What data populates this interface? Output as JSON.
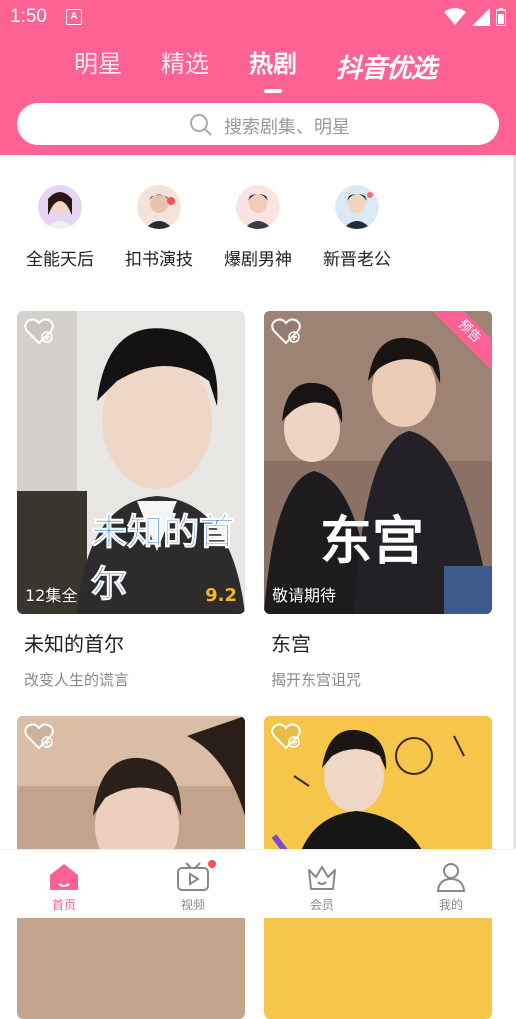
{
  "status_bar": {
    "time": "1:50",
    "notification_icon_letter": "A"
  },
  "top_tabs": [
    {
      "label": "明星",
      "active": false
    },
    {
      "label": "精选",
      "active": false
    },
    {
      "label": "热剧",
      "active": true
    }
  ],
  "brand_tab": {
    "label": "抖音优选"
  },
  "search": {
    "placeholder": "搜索剧集、明星"
  },
  "categories": [
    {
      "label": "全能天后"
    },
    {
      "label": "扣书演技"
    },
    {
      "label": "爆剧男神"
    },
    {
      "label": "新晋老公"
    }
  ],
  "cards": [
    {
      "poster_title": "未知的首尔",
      "badge": "12集全",
      "score": "9.2",
      "title": "未知的首尔",
      "subtitle": "改变人生的谎言"
    },
    {
      "poster_title": "东宫",
      "badge": "敬请期待",
      "corner_tag": "预告",
      "title": "东宫",
      "subtitle": "揭开东宫诅咒"
    },
    {
      "title": "",
      "subtitle": ""
    },
    {
      "title": "",
      "subtitle": ""
    }
  ],
  "bottom_nav": [
    {
      "label": "首页",
      "icon": "home-icon",
      "active": true
    },
    {
      "label": "视频",
      "icon": "tv-icon",
      "active": false
    },
    {
      "label": "会员",
      "icon": "crown-icon",
      "active": false
    },
    {
      "label": "我的",
      "icon": "user-icon",
      "active": false
    }
  ],
  "colors": {
    "brand": "#fd6293",
    "score": "#f5b526"
  }
}
